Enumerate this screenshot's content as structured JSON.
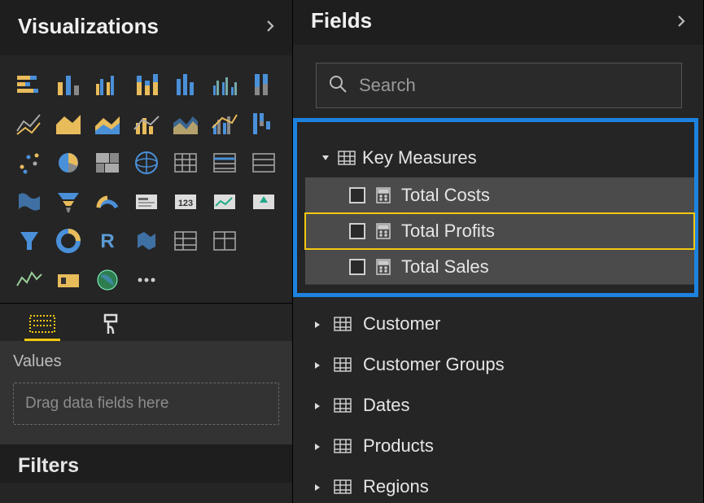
{
  "left": {
    "visualizations_title": "Visualizations",
    "values_label": "Values",
    "drop_hint": "Drag data fields here",
    "filters_title": "Filters"
  },
  "right": {
    "fields_title": "Fields",
    "search_placeholder": "Search",
    "expanded_table": "Key Measures",
    "measures": [
      {
        "label": "Total Costs",
        "selected": false
      },
      {
        "label": "Total Profits",
        "selected": true
      },
      {
        "label": "Total Sales",
        "selected": false
      }
    ],
    "tables": [
      "Customer",
      "Customer Groups",
      "Dates",
      "Products",
      "Regions"
    ]
  },
  "viz_icons": [
    "stacked-bar",
    "column",
    "clustered-column",
    "stacked-column",
    "clustered-bar",
    "clustered-column-2",
    "100-stacked-column",
    "line",
    "area",
    "area-stacked",
    "line-column",
    "ribbon",
    "line-clustered",
    "waterfall",
    "scatter",
    "pie",
    "treemap",
    "donut",
    "matrix",
    "table",
    "slicer",
    "map",
    "funnel",
    "gauge",
    "card",
    "multi-row-card",
    "kpi",
    "kpi-arrow",
    "slicer-filter",
    "ring",
    "r-visual",
    "shape-map",
    "table-2",
    "table-3",
    "python",
    "key-influencers",
    "globe",
    "more"
  ]
}
